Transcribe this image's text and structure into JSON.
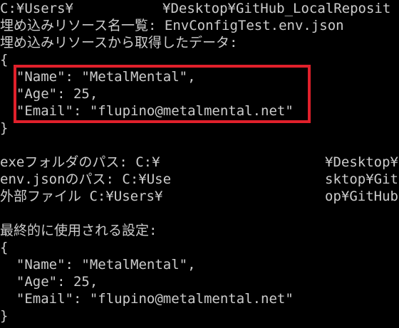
{
  "theme": {
    "background": "#000000",
    "foreground": "#cccccc",
    "highlight_border": "#e0202b"
  },
  "terminal": {
    "path_line": {
      "left": "C:¥Users¥",
      "right": "¥Desktop¥GitHub_LocalReposit"
    },
    "embedded_list_line": "埋め込みリソース名一覧: EnvConfigTest.env.json",
    "embedded_data_label": "埋め込みリソースから取得したデータ:",
    "embedded_json": {
      "open_brace": "{",
      "name_line": "  \"Name\": \"MetalMental\",",
      "age_line": "  \"Age\": 25,",
      "email_line": "  \"Email\": \"flupino@metalmental.net\"",
      "close_brace": "}"
    },
    "exe_folder": {
      "left": "exeフォルダのパス: C:¥",
      "right": "¥Desktop¥"
    },
    "env_json_path": {
      "left": "env.jsonのパス: C:¥Use",
      "right": "sktop¥Git"
    },
    "external_file": {
      "left": "外部ファイル C:¥Users¥",
      "right": "op¥GitHub"
    },
    "final_settings_label": "最終的に使用される設定:",
    "final_json": {
      "open_brace": "{",
      "name_line": "  \"Name\": \"MetalMental\",",
      "age_line": "  \"Age\": 25,",
      "email_line": "  \"Email\": \"flupino@metalmental.net\"",
      "close_brace": "}"
    }
  }
}
